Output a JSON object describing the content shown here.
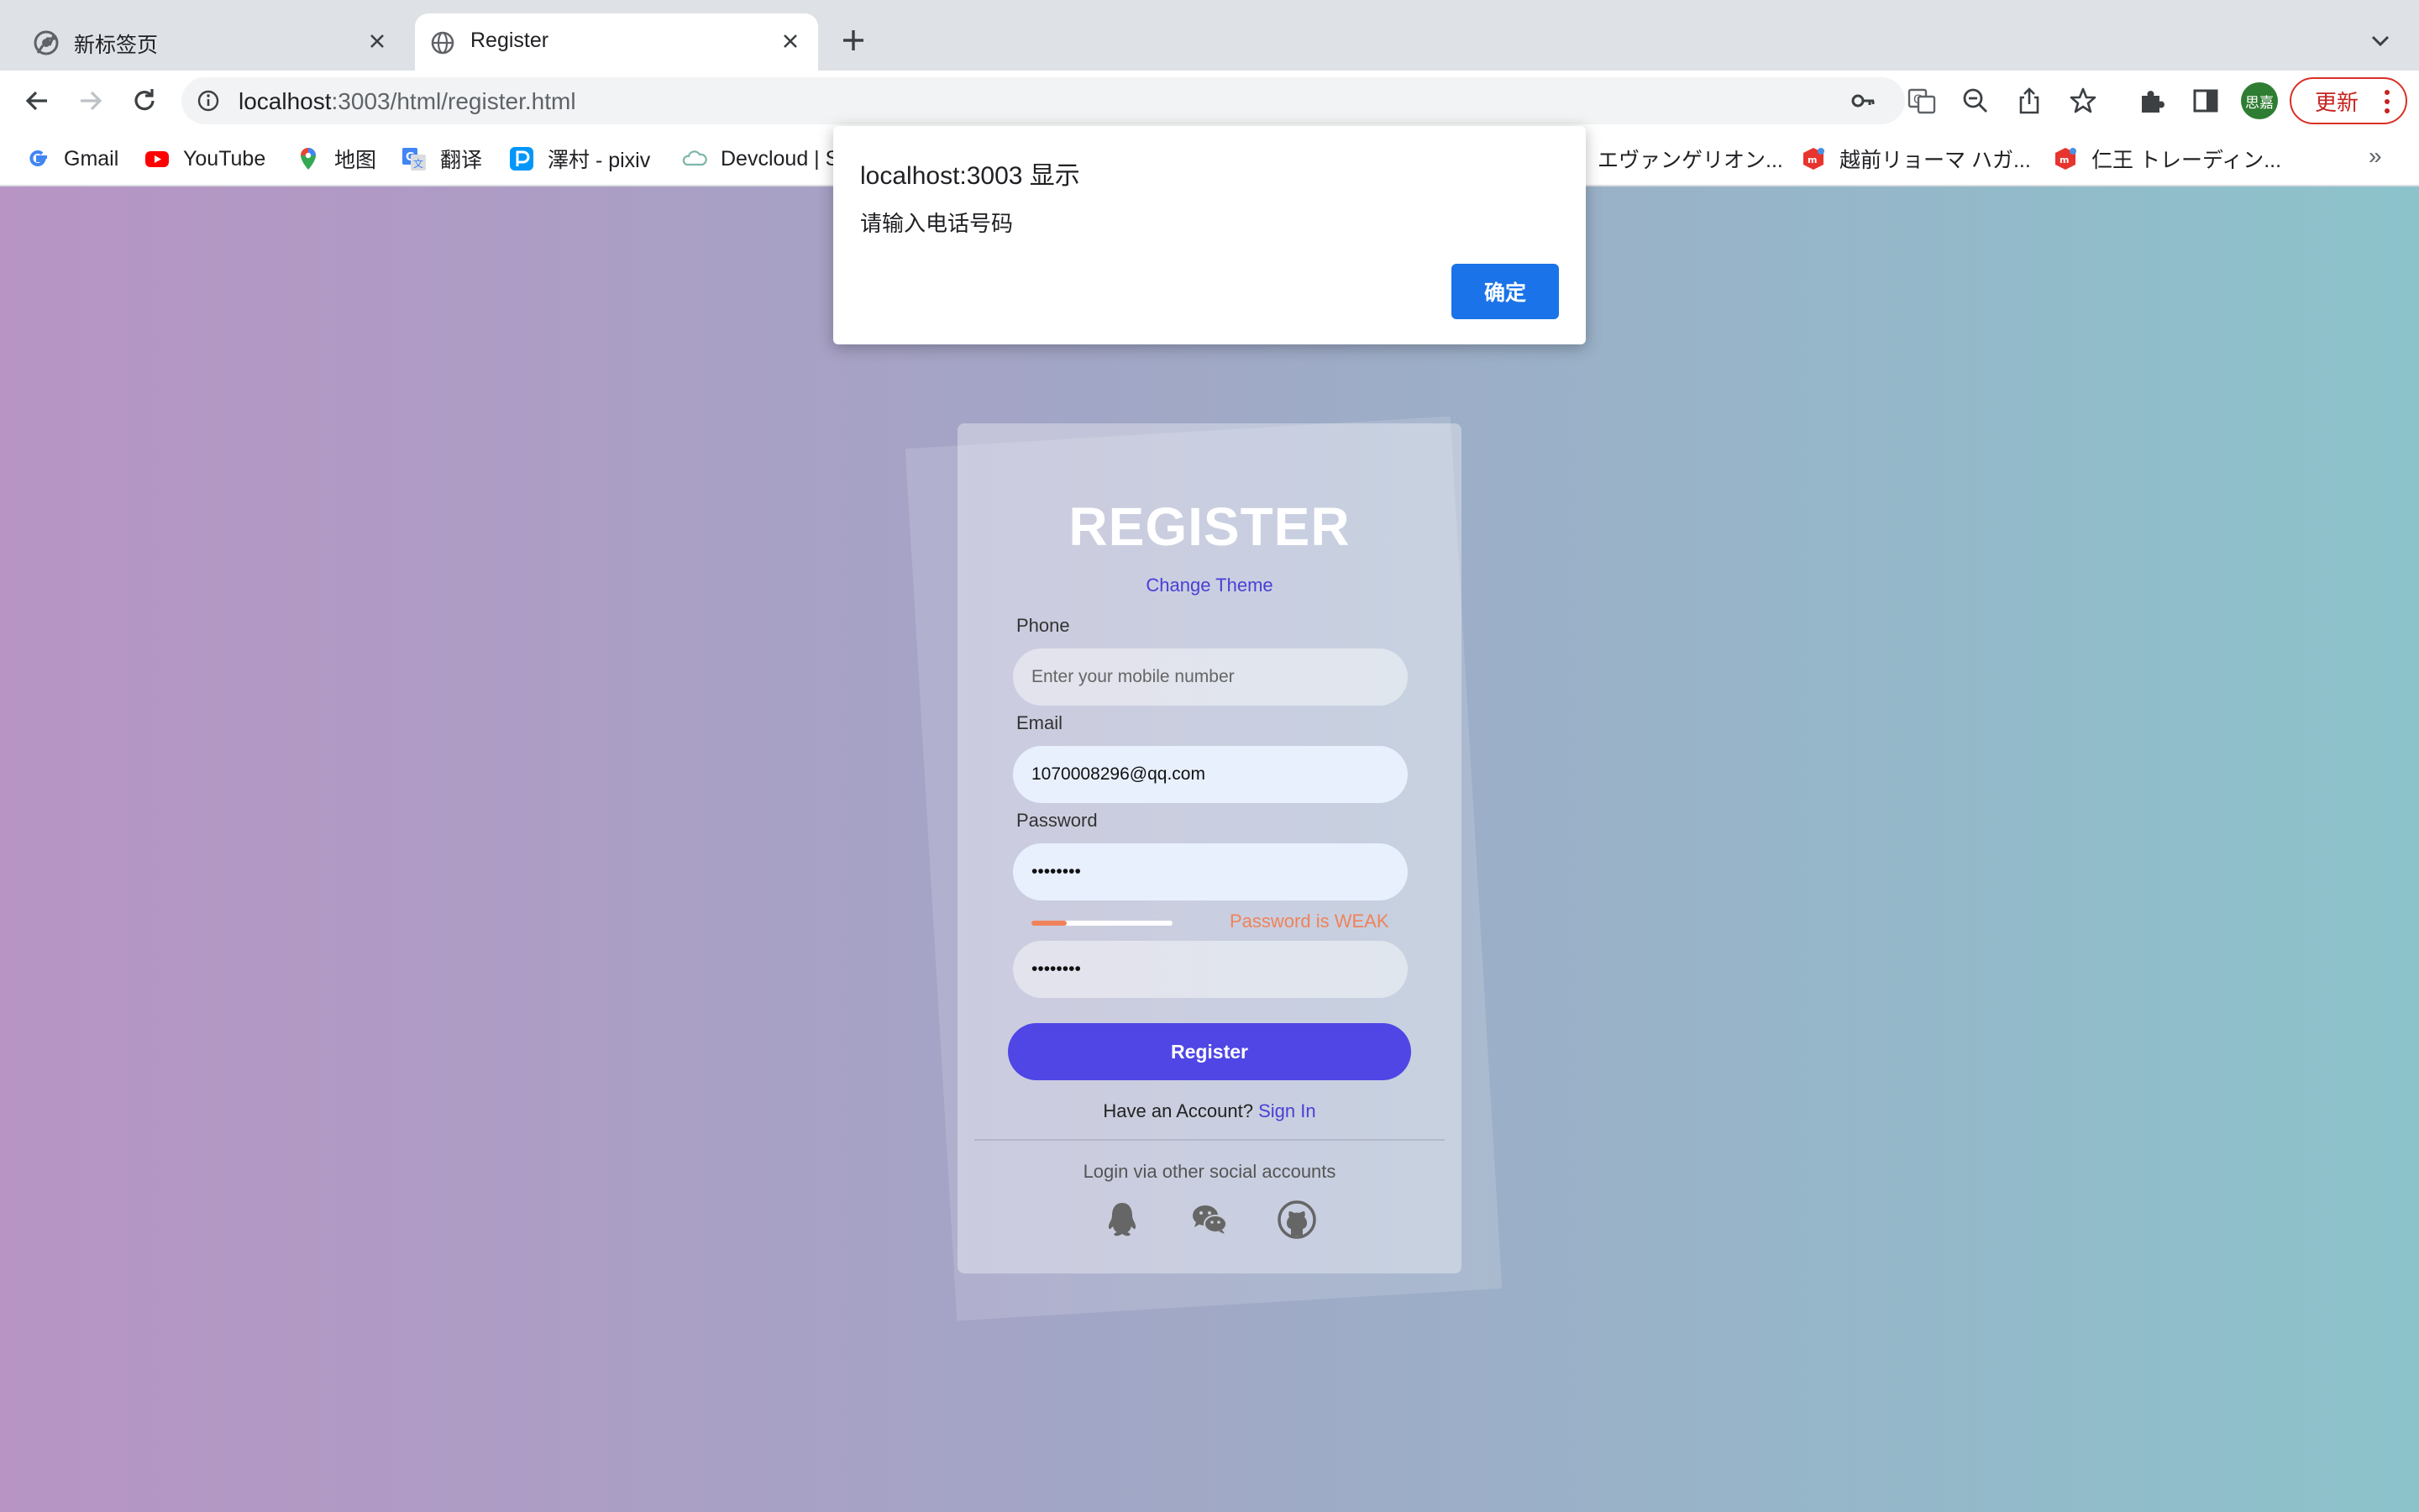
{
  "browser": {
    "tabs": [
      {
        "title": "新标签页",
        "active": false
      },
      {
        "title": "Register",
        "active": true
      }
    ],
    "address": {
      "host": "localhost",
      "rest": ":3003/html/register.html"
    },
    "profile_initials": "思嘉",
    "update_label": "更新",
    "bookmarks": [
      {
        "label": "Gmail",
        "icon": "google-icon"
      },
      {
        "label": "YouTube",
        "icon": "youtube-icon"
      },
      {
        "label": "地图",
        "icon": "maps-icon"
      },
      {
        "label": "翻译",
        "icon": "translate-icon"
      },
      {
        "label": "澤村 - pixiv",
        "icon": "pixiv-icon"
      },
      {
        "label": "Devcloud | S",
        "icon": "devcloud-icon"
      },
      {
        "label": "エヴァンゲリオン...",
        "icon": "evangelion-icon"
      },
      {
        "label": "越前リョーマ ハガ...",
        "icon": "mercari-icon"
      },
      {
        "label": "仁王 トレーディン...",
        "icon": "mercari-icon"
      }
    ],
    "bookmarks_more": "»"
  },
  "dialog": {
    "title": "localhost:3003 显示",
    "message": "请输入电话号码",
    "ok_label": "确定"
  },
  "form": {
    "title": "REGISTER",
    "change_theme": "Change Theme",
    "phone": {
      "label": "Phone",
      "placeholder": "Enter your mobile number",
      "value": ""
    },
    "email": {
      "label": "Email",
      "value": "1070008296@qq.com"
    },
    "password": {
      "label": "Password",
      "value": "••••••••"
    },
    "strength": {
      "text": "Password is WEAK",
      "level": 0.25
    },
    "confirm_password": {
      "value": "••••••••"
    },
    "submit_label": "Register",
    "have_account": "Have an Account?",
    "sign_in": "Sign In",
    "social_label": "Login via other social accounts",
    "social": [
      "qq-icon",
      "wechat-icon",
      "github-icon"
    ]
  },
  "colors": {
    "accent": "#4f46e5",
    "link": "#4a3fd6",
    "weak": "#f0825a",
    "dialog_button": "#1a73e8"
  }
}
